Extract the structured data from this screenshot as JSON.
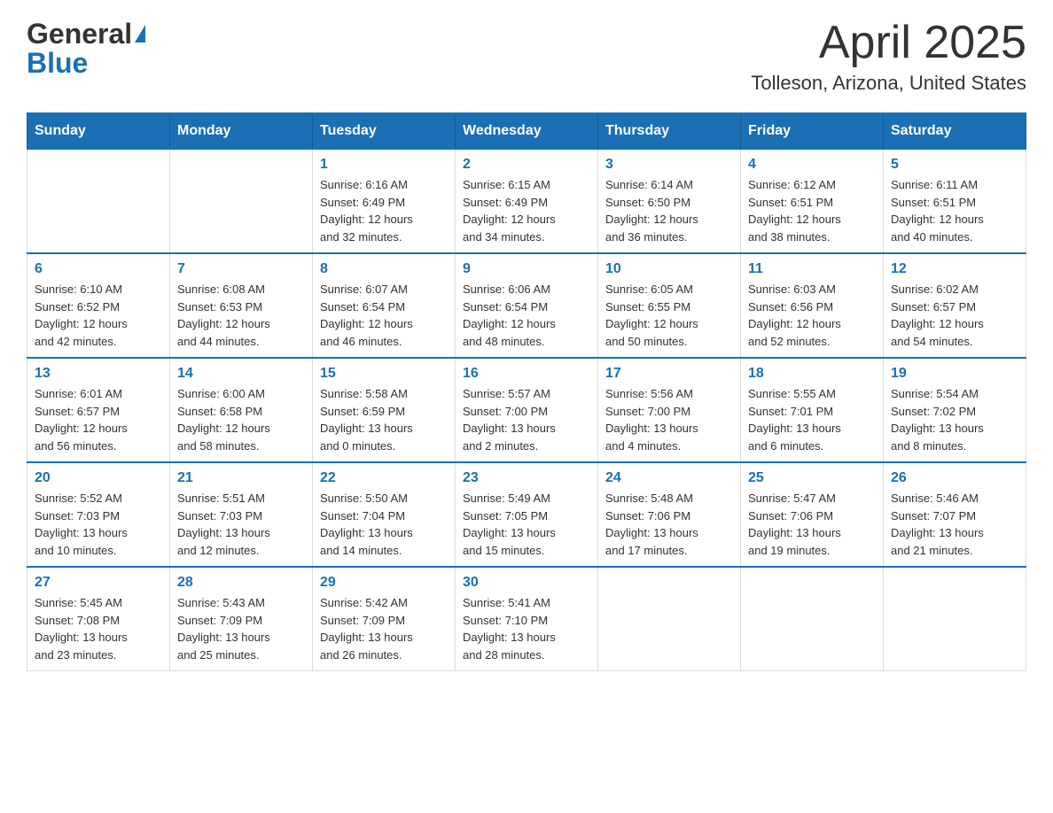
{
  "header": {
    "logo_general": "General",
    "logo_blue": "Blue",
    "month_title": "April 2025",
    "location": "Tolleson, Arizona, United States"
  },
  "days_of_week": [
    "Sunday",
    "Monday",
    "Tuesday",
    "Wednesday",
    "Thursday",
    "Friday",
    "Saturday"
  ],
  "weeks": [
    [
      {
        "day": "",
        "info": ""
      },
      {
        "day": "",
        "info": ""
      },
      {
        "day": "1",
        "info": "Sunrise: 6:16 AM\nSunset: 6:49 PM\nDaylight: 12 hours\nand 32 minutes."
      },
      {
        "day": "2",
        "info": "Sunrise: 6:15 AM\nSunset: 6:49 PM\nDaylight: 12 hours\nand 34 minutes."
      },
      {
        "day": "3",
        "info": "Sunrise: 6:14 AM\nSunset: 6:50 PM\nDaylight: 12 hours\nand 36 minutes."
      },
      {
        "day": "4",
        "info": "Sunrise: 6:12 AM\nSunset: 6:51 PM\nDaylight: 12 hours\nand 38 minutes."
      },
      {
        "day": "5",
        "info": "Sunrise: 6:11 AM\nSunset: 6:51 PM\nDaylight: 12 hours\nand 40 minutes."
      }
    ],
    [
      {
        "day": "6",
        "info": "Sunrise: 6:10 AM\nSunset: 6:52 PM\nDaylight: 12 hours\nand 42 minutes."
      },
      {
        "day": "7",
        "info": "Sunrise: 6:08 AM\nSunset: 6:53 PM\nDaylight: 12 hours\nand 44 minutes."
      },
      {
        "day": "8",
        "info": "Sunrise: 6:07 AM\nSunset: 6:54 PM\nDaylight: 12 hours\nand 46 minutes."
      },
      {
        "day": "9",
        "info": "Sunrise: 6:06 AM\nSunset: 6:54 PM\nDaylight: 12 hours\nand 48 minutes."
      },
      {
        "day": "10",
        "info": "Sunrise: 6:05 AM\nSunset: 6:55 PM\nDaylight: 12 hours\nand 50 minutes."
      },
      {
        "day": "11",
        "info": "Sunrise: 6:03 AM\nSunset: 6:56 PM\nDaylight: 12 hours\nand 52 minutes."
      },
      {
        "day": "12",
        "info": "Sunrise: 6:02 AM\nSunset: 6:57 PM\nDaylight: 12 hours\nand 54 minutes."
      }
    ],
    [
      {
        "day": "13",
        "info": "Sunrise: 6:01 AM\nSunset: 6:57 PM\nDaylight: 12 hours\nand 56 minutes."
      },
      {
        "day": "14",
        "info": "Sunrise: 6:00 AM\nSunset: 6:58 PM\nDaylight: 12 hours\nand 58 minutes."
      },
      {
        "day": "15",
        "info": "Sunrise: 5:58 AM\nSunset: 6:59 PM\nDaylight: 13 hours\nand 0 minutes."
      },
      {
        "day": "16",
        "info": "Sunrise: 5:57 AM\nSunset: 7:00 PM\nDaylight: 13 hours\nand 2 minutes."
      },
      {
        "day": "17",
        "info": "Sunrise: 5:56 AM\nSunset: 7:00 PM\nDaylight: 13 hours\nand 4 minutes."
      },
      {
        "day": "18",
        "info": "Sunrise: 5:55 AM\nSunset: 7:01 PM\nDaylight: 13 hours\nand 6 minutes."
      },
      {
        "day": "19",
        "info": "Sunrise: 5:54 AM\nSunset: 7:02 PM\nDaylight: 13 hours\nand 8 minutes."
      }
    ],
    [
      {
        "day": "20",
        "info": "Sunrise: 5:52 AM\nSunset: 7:03 PM\nDaylight: 13 hours\nand 10 minutes."
      },
      {
        "day": "21",
        "info": "Sunrise: 5:51 AM\nSunset: 7:03 PM\nDaylight: 13 hours\nand 12 minutes."
      },
      {
        "day": "22",
        "info": "Sunrise: 5:50 AM\nSunset: 7:04 PM\nDaylight: 13 hours\nand 14 minutes."
      },
      {
        "day": "23",
        "info": "Sunrise: 5:49 AM\nSunset: 7:05 PM\nDaylight: 13 hours\nand 15 minutes."
      },
      {
        "day": "24",
        "info": "Sunrise: 5:48 AM\nSunset: 7:06 PM\nDaylight: 13 hours\nand 17 minutes."
      },
      {
        "day": "25",
        "info": "Sunrise: 5:47 AM\nSunset: 7:06 PM\nDaylight: 13 hours\nand 19 minutes."
      },
      {
        "day": "26",
        "info": "Sunrise: 5:46 AM\nSunset: 7:07 PM\nDaylight: 13 hours\nand 21 minutes."
      }
    ],
    [
      {
        "day": "27",
        "info": "Sunrise: 5:45 AM\nSunset: 7:08 PM\nDaylight: 13 hours\nand 23 minutes."
      },
      {
        "day": "28",
        "info": "Sunrise: 5:43 AM\nSunset: 7:09 PM\nDaylight: 13 hours\nand 25 minutes."
      },
      {
        "day": "29",
        "info": "Sunrise: 5:42 AM\nSunset: 7:09 PM\nDaylight: 13 hours\nand 26 minutes."
      },
      {
        "day": "30",
        "info": "Sunrise: 5:41 AM\nSunset: 7:10 PM\nDaylight: 13 hours\nand 28 minutes."
      },
      {
        "day": "",
        "info": ""
      },
      {
        "day": "",
        "info": ""
      },
      {
        "day": "",
        "info": ""
      }
    ]
  ]
}
